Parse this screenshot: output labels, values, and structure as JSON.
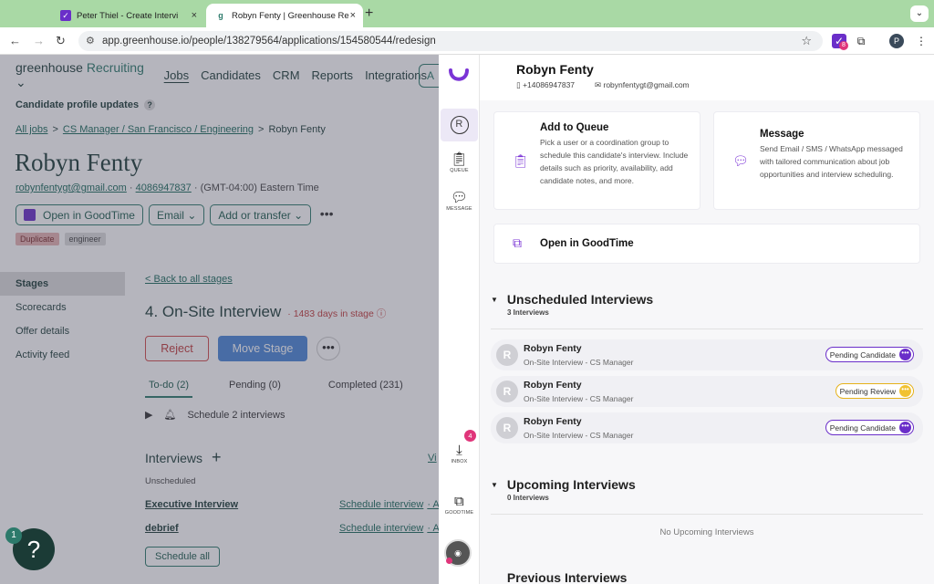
{
  "browser": {
    "tabs": [
      {
        "title": "Peter Thiel - Create Intervi",
        "favicon": "goodtime-icon"
      },
      {
        "title": "Robyn Fenty | Greenhouse Re",
        "favicon": "greenhouse-icon"
      }
    ],
    "url": "app.greenhouse.io/people/138279564/applications/154580544/redesign",
    "ext_badge": "8",
    "profile_initial": "P"
  },
  "greenhouse": {
    "logo_word": "greenhouse",
    "logo_product": "Recruiting",
    "nav": [
      "Jobs",
      "Candidates",
      "CRM",
      "Reports",
      "Integrations"
    ],
    "nav_partial_button": "A",
    "profile_updates": "Candidate profile updates",
    "breadcrumb": [
      "All jobs",
      "CS Manager / San Francisco / Engineering",
      "Robyn Fenty"
    ],
    "candidate": {
      "name": "Robyn Fenty",
      "email": "robynfentygt@gmail.com",
      "phone": "4086947837",
      "timezone": "(GMT-04:00) Eastern Time"
    },
    "buttons": {
      "goodtime": "Open in GoodTime",
      "email": "Email",
      "add_transfer": "Add or transfer"
    },
    "tags": [
      "Duplicate",
      "engineer"
    ],
    "sidebar": [
      "Stages",
      "Scorecards",
      "Offer details",
      "Activity feed"
    ],
    "back_link": "Back to all stages",
    "stage": {
      "title": "4. On-Site Interview",
      "days": "1483 days in stage"
    },
    "actions": {
      "reject": "Reject",
      "move": "Move Stage"
    },
    "subtabs": [
      "To-do (2)",
      "Pending (0)",
      "Completed (231)"
    ],
    "schedule_text": "Schedule 2 interviews",
    "interviews_title": "Interviews",
    "interviews_link_partial": "Vi",
    "unscheduled_label": "Unscheduled",
    "interview_rows": [
      {
        "name": "Executive Interview",
        "action": "Schedule interview",
        "extra": "As"
      },
      {
        "name": "debrief",
        "action": "Schedule interview",
        "extra": "As"
      }
    ],
    "schedule_all": "Schedule all",
    "help_badge": "1",
    "help_icon": "?"
  },
  "goodtime": {
    "rail": {
      "avatar_initial": "R",
      "items": [
        {
          "label": "QUEUE",
          "icon": "clipboard-icon"
        },
        {
          "label": "MESSAGE",
          "icon": "chat-icon"
        },
        {
          "label": "INBOX",
          "icon": "inbox-icon"
        },
        {
          "label": "GOODTIME",
          "icon": "external-link-icon"
        }
      ],
      "inbox_badge": "4"
    },
    "header": {
      "name": "Robyn Fenty",
      "phone": "+14086947837",
      "email": "robynfentygt@gmail.com"
    },
    "cards": {
      "queue": {
        "title": "Add to Queue",
        "desc": "Pick a user or a coordination group to schedule this candidate's interview. Include details such as priority, availability, add candidate notes, and more."
      },
      "message": {
        "title": "Message",
        "desc": "Send Email / SMS / WhatsApp messaged with tailored communication about job opportunities and interview scheduling."
      },
      "open": {
        "title": "Open in GoodTime"
      }
    },
    "unscheduled": {
      "title": "Unscheduled Interviews",
      "count": "3 Interviews",
      "items": [
        {
          "initial": "R",
          "name": "Robyn Fenty",
          "type": "On-Site Interview - CS Manager",
          "status": "Pending Candidate"
        },
        {
          "initial": "R",
          "name": "Robyn Fenty",
          "type": "On-Site Interview - CS Manager",
          "status": "Pending Review"
        },
        {
          "initial": "R",
          "name": "Robyn Fenty",
          "type": "On-Site Interview - CS Manager",
          "status": "Pending Candidate"
        }
      ]
    },
    "upcoming": {
      "title": "Upcoming Interviews",
      "count": "0 Interviews",
      "empty": "No Upcoming Interviews"
    },
    "previous": {
      "title": "Previous Interviews"
    }
  },
  "colors": {
    "brand_purple": "#6a2ec9",
    "greenhouse_green": "#2c7a6b",
    "pending_review": "#f1c232",
    "tab_bar": "#a9d9a5"
  }
}
